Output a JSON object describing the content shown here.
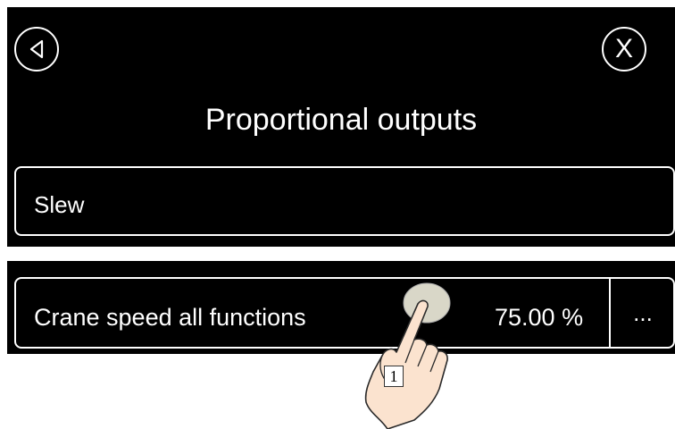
{
  "header": {
    "back_icon": "back-arrow-icon",
    "close_label": "X",
    "title": "Proportional outputs"
  },
  "field": {
    "value": "Slew"
  },
  "crane_speed_row": {
    "label": "Crane speed all functions",
    "value": "75.00 %",
    "more_label": "..."
  },
  "annotation": {
    "step_number": "1",
    "hand_icon": "tapping-hand-icon"
  }
}
